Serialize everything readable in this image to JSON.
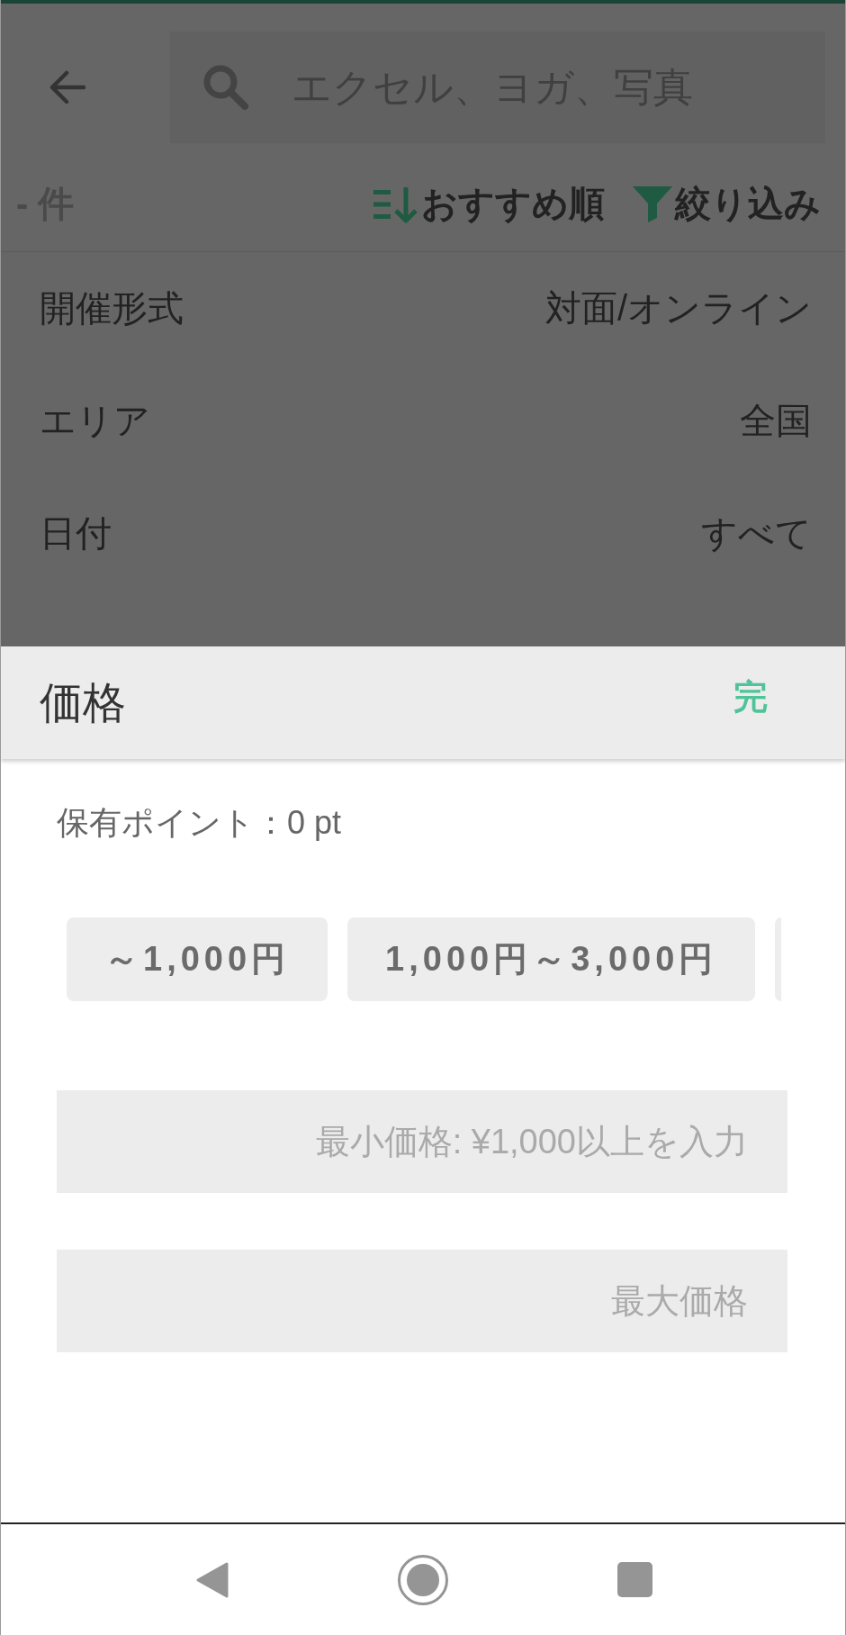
{
  "header": {
    "search": {
      "placeholder": "エクセル、ヨガ、写真"
    }
  },
  "toolbar": {
    "result_count": "- 件",
    "sort": {
      "label": "おすすめ順"
    },
    "filter": {
      "label": "絞り込み"
    }
  },
  "filters": [
    {
      "label": "開催形式",
      "value": "対面/オンライン"
    },
    {
      "label": "エリア",
      "value": "全国"
    },
    {
      "label": "日付",
      "value": "すべて"
    }
  ],
  "sheet": {
    "title": "価格",
    "done_button": "完",
    "points": "保有ポイント：0 pt",
    "chips": [
      {
        "label": "～1,000円",
        "selected": false
      },
      {
        "label": "1,000円～3,000円",
        "selected": false
      }
    ],
    "fields": [
      {
        "placeholder": "最小価格: ¥1,000以上を入力"
      },
      {
        "placeholder": "最大価格"
      }
    ]
  }
}
